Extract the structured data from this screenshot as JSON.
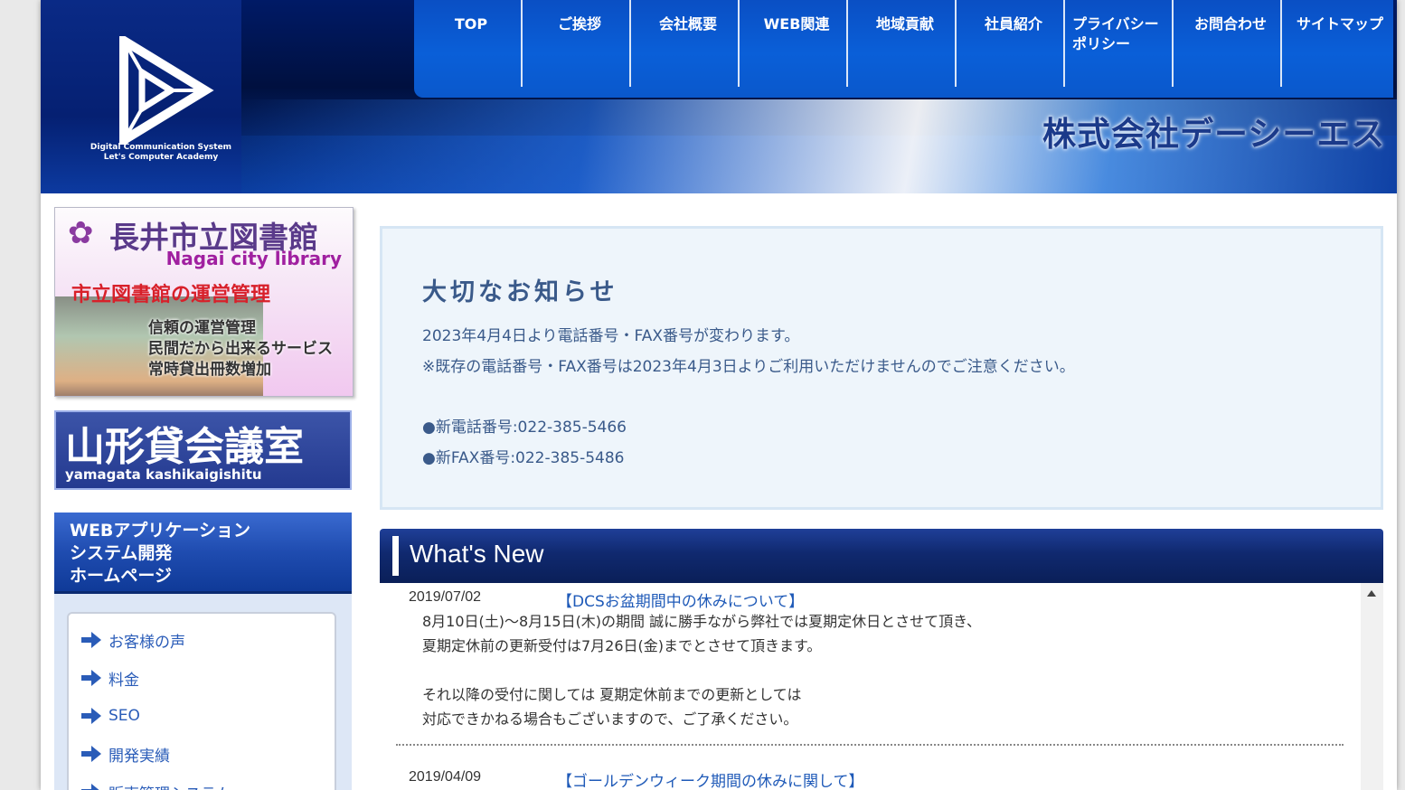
{
  "header": {
    "logo_text_line1": "Digital Communication System",
    "logo_text_line2": "Let's Computer Academy",
    "company_name": "株式会社デーシーエス",
    "nav": [
      {
        "label": "TOP"
      },
      {
        "label": "ご挨拶"
      },
      {
        "label": "会社概要"
      },
      {
        "label": "WEB関連"
      },
      {
        "label": "地域貢献"
      },
      {
        "label": "社員紹介"
      },
      {
        "label": "プライバシーポリシー"
      },
      {
        "label": "お問合わせ"
      },
      {
        "label": "サイトマップ"
      }
    ]
  },
  "sidebar": {
    "library_banner": {
      "title": "長井市立図書館",
      "subtitle": "Nagai city library",
      "heading": "市立図書館の運営管理",
      "lines": [
        "信頼の運営管理",
        "民間だから出来るサービス",
        "常時貸出冊数増加"
      ]
    },
    "yamagata_banner": {
      "title": "山形貸会議室",
      "subtitle": "yamagata kashikaigishitu"
    },
    "menu_heading": [
      "WEBアプリケーション",
      "システム開発",
      "ホームページ"
    ],
    "menu_items": [
      {
        "label": "お客様の声"
      },
      {
        "label": "料金"
      },
      {
        "label": "SEO"
      },
      {
        "label": "開発実績"
      },
      {
        "label": "販売管理システム"
      }
    ]
  },
  "notice": {
    "title": "大切なお知らせ",
    "line1": "2023年4月4日より電話番号・FAX番号が変わります。",
    "line2": "※既存の電話番号・FAX番号は2023年4月3日よりご利用いただけませんのでご注意ください。",
    "phone": "●新電話番号:022-385-5466",
    "fax": "●新FAX番号:022-385-5486"
  },
  "whats_new": {
    "title": "What's New",
    "items": [
      {
        "date": "2019/07/02",
        "title": "【DCSお盆期間中の休みについて】",
        "body": [
          "8月10日(土)～8月15日(木)の期間 誠に勝手ながら弊社では夏期定休日とさせて頂き、",
          "夏期定休前の更新受付は7月26日(金)までとさせて頂きます。",
          "",
          "それ以降の受付に関しては 夏期定休前までの更新としては",
          "対応できかねる場合もございますので、ご了承ください。"
        ]
      },
      {
        "date": "2019/04/09",
        "title": "【ゴールデンウィーク期間の休みに関して】",
        "body": []
      }
    ]
  },
  "colors": {
    "nav_blue": "#0a58cc",
    "header_dark": "#00103f",
    "link_blue": "#1f5ab8",
    "notice_text": "#3a5a8a"
  }
}
